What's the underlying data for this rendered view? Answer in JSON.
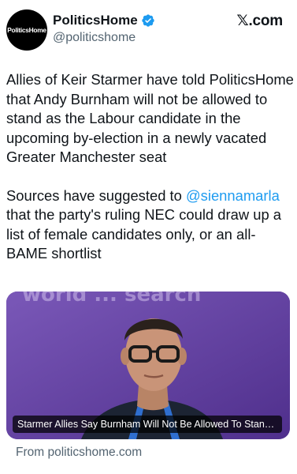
{
  "author": {
    "avatar_text": "PoliticsHome",
    "display_name": "PoliticsHome",
    "handle": "@politicshome",
    "verified": true
  },
  "brand": {
    "label": "𝕏.com"
  },
  "tweet": {
    "paragraph_1": "Allies of Keir Starmer have told PoliticsHome that Andy Burnham will not be allowed to stand as the Labour candidate in the upcoming by-election in a newly vacated Greater Manchester seat",
    "paragraph_2_before": "Sources have suggested to ",
    "paragraph_2_mention": "@siennamarla",
    "paragraph_2_after": " that the party's ruling NEC could draw up a list of female candidates only, or an all-BAME shortlist"
  },
  "link_card": {
    "background_text": "world ... search",
    "caption": "Starmer Allies Say Burnham Will Not Be Allowed To Stand F...",
    "source": "From politicshome.com"
  },
  "colors": {
    "link": "#1d9bf0",
    "verified_badge": "#1d9bf0",
    "muted": "#536471",
    "card_bg": "#6a4aa6"
  }
}
